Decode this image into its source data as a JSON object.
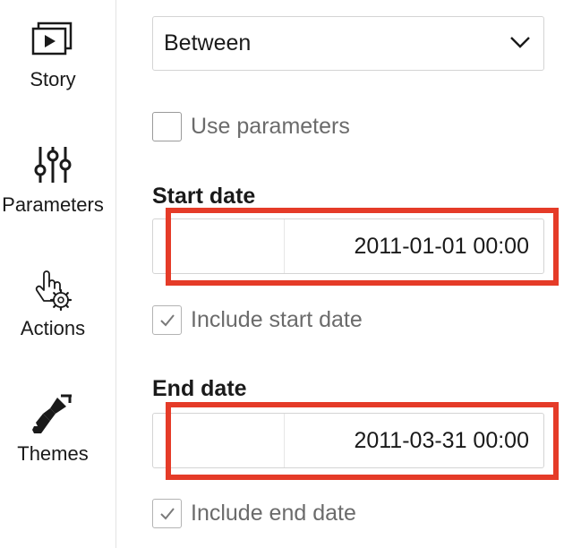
{
  "rail": {
    "items": [
      {
        "label": "Story",
        "icon": "story-icon"
      },
      {
        "label": "Parameters",
        "icon": "sliders-icon"
      },
      {
        "label": "Actions",
        "icon": "hand-gear-icon"
      },
      {
        "label": "Themes",
        "icon": "brush-icon"
      }
    ]
  },
  "filter": {
    "mode_select": {
      "value": "Between",
      "icon": "chevron-down-icon"
    },
    "use_parameters": {
      "label": "Use parameters",
      "checked": false
    },
    "start": {
      "label": "Start date",
      "value": "2011-01-01 00:00",
      "include_label": "Include start date",
      "include_checked": true
    },
    "end": {
      "label": "End date",
      "value": "2011-03-31 00:00",
      "include_label": "Include end date",
      "include_checked": true
    }
  },
  "colors": {
    "highlight": "#e53b28",
    "border": "#d4d4d4",
    "muted_text": "#6b6b6b"
  }
}
